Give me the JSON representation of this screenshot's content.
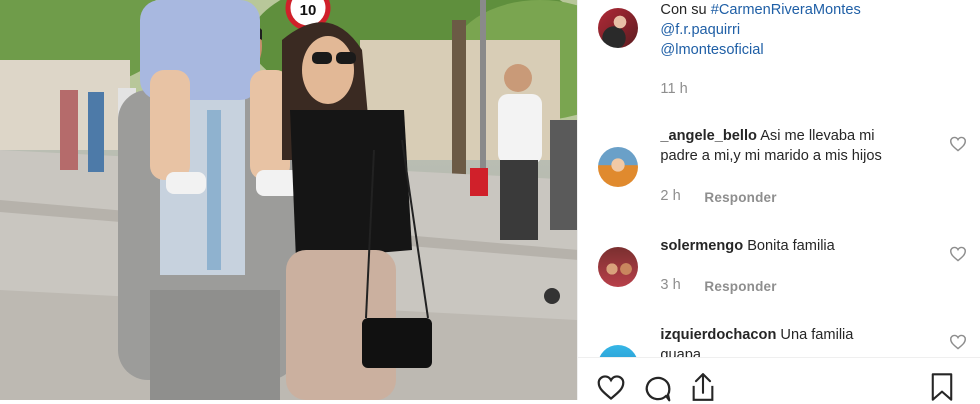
{
  "caption": {
    "line1_prefix": "Con su ",
    "line1_tag": "#CarmenRiveraMontes",
    "line2": "@f.r.paquirri",
    "line3": "@lmontesoficial",
    "time": "11 h"
  },
  "comments": [
    {
      "user": "_angele_bello",
      "text": "Asi me llevaba mi",
      "text2": "padre a mi,y mi marido a mis hijos",
      "time": "2 h",
      "reply": "Responder"
    },
    {
      "user": "solermengo",
      "text": "Bonita familia",
      "time": "3 h",
      "reply": "Responder"
    },
    {
      "user": "izquierdochacon",
      "text": "Una familia",
      "text2": "guapa"
    }
  ],
  "photo": {
    "sign": "10"
  },
  "icons": {
    "like": "heart-icon",
    "comment": "comment-icon",
    "share": "share-icon",
    "save": "bookmark-icon",
    "comment_like": "heart-outline-icon"
  }
}
